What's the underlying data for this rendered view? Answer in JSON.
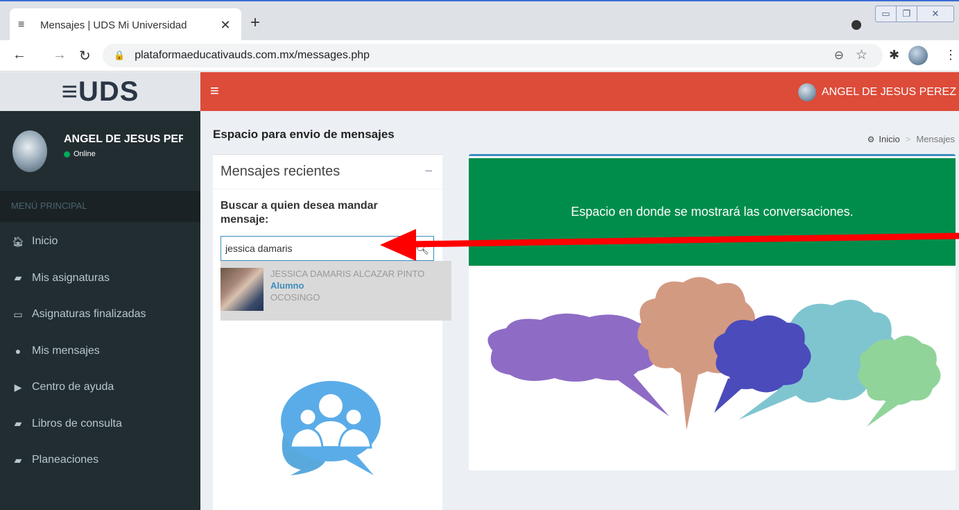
{
  "browser": {
    "tab_title": "Mensajes | UDS Mi Universidad",
    "url": "plataformaeducativauds.com.mx/messages.php"
  },
  "brand": {
    "logo_text": "UDS"
  },
  "topnav": {
    "user_name": "ANGEL DE JESUS PEREZ"
  },
  "sidebar": {
    "user_name": "ANGEL DE JESUS PEREZ",
    "status": "Online",
    "header": "MENÚ PRINCIPAL",
    "items": [
      {
        "label": "Inicio",
        "icon": "home-icon"
      },
      {
        "label": "Mis asignaturas",
        "icon": "book-icon"
      },
      {
        "label": "Asignaturas finalizadas",
        "icon": "desktop-icon"
      },
      {
        "label": "Mis mensajes",
        "icon": "comments-icon"
      },
      {
        "label": "Centro de ayuda",
        "icon": "youtube-icon"
      },
      {
        "label": "Libros de consulta",
        "icon": "book-icon"
      },
      {
        "label": "Planeaciones",
        "icon": "book-icon"
      }
    ]
  },
  "content": {
    "title": "Espacio para envio de mensajes",
    "breadcrumb": {
      "home": "Inicio",
      "current": "Mensajes"
    }
  },
  "recent": {
    "title": "Mensajes recientes",
    "search_label": "Buscar a quien desea mandar mensaje:",
    "search_value": "jessica damaris",
    "result": {
      "name": "JESSICA DAMARIS ALCAZAR PINTO",
      "role": "Alumno",
      "city": "OCOSINGO"
    }
  },
  "conversation": {
    "banner_text": "Espacio en donde se mostrará las conversaciones."
  },
  "colors": {
    "topnav": "#dd4b39",
    "sidebar": "#222d32",
    "banner": "#008d4c",
    "accent": "#3c8dbc",
    "annotation_arrow": "#ff0000"
  }
}
